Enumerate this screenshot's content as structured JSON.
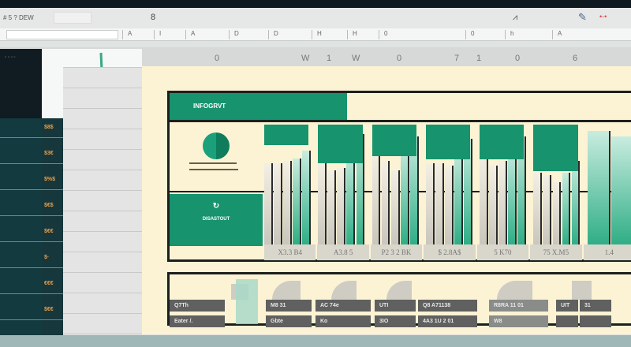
{
  "toolbar": {
    "left_text": "# 5 ? DEW",
    "cell_ref": "8"
  },
  "formula_cells": [
    "A",
    "I",
    "A",
    "D",
    "D",
    "H",
    "H",
    "0",
    "0",
    "h",
    "A"
  ],
  "columns": [
    "0",
    "W",
    "1",
    "W",
    "0",
    "7",
    "1",
    "0",
    "6"
  ],
  "left_labels": [
    "$8$",
    "$3€",
    "$%$",
    "$€$",
    "$€€",
    "$·",
    "€€€",
    "$€€"
  ],
  "dashboard": {
    "title": "INFOGRVT",
    "subtitle": "DISASTOUT",
    "accent_color": "#17936d",
    "background_color": "#fbf3d4",
    "groups": [
      {
        "label": "X3.3 B4",
        "block": 0.17,
        "bars": [
          0.68,
          0.68,
          0.7,
          0.72,
          0.78
        ]
      },
      {
        "label": "A3.8 5",
        "block": 0.32,
        "bars": [
          0.7,
          0.62,
          0.64,
          0.78,
          0.92
        ]
      },
      {
        "label": "P2 3 2 BK",
        "block": 0.26,
        "bars": [
          0.76,
          0.7,
          0.62,
          0.82,
          0.9
        ]
      },
      {
        "label": "$ 2.8A$",
        "block": 0.29,
        "bars": [
          0.68,
          0.68,
          0.66,
          0.8,
          0.88
        ]
      },
      {
        "label": "5 K70",
        "block": 0.29,
        "bars": [
          0.76,
          0.66,
          0.7,
          0.8,
          0.9
        ]
      },
      {
        "label": "75 X.M5",
        "block": 0.39,
        "bars": [
          0.6,
          0.58,
          0.52,
          0.6,
          0.7
        ]
      },
      {
        "label": "1.4",
        "block": 0.0,
        "bars": [
          0.95,
          0.9
        ]
      }
    ]
  },
  "table": {
    "row1": [
      "Q7Th",
      "M8 31",
      "AC 74e",
      "UTI",
      "Q8 A71138",
      "R8RA 11 01",
      "UIT",
      "31"
    ],
    "row2": [
      "Eater /.",
      "Gbte",
      "Ko",
      "3IO",
      "4A3 1U 2 01",
      "W8",
      "",
      ""
    ]
  }
}
